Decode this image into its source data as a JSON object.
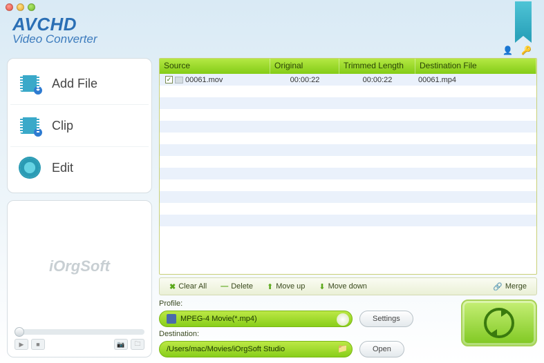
{
  "brand": {
    "line1": "AVCHD",
    "line2": "Video Converter"
  },
  "sidebar": {
    "items": [
      {
        "label": "Add File"
      },
      {
        "label": "Clip"
      },
      {
        "label": "Edit"
      }
    ]
  },
  "preview": {
    "watermark": "iOrgSoft"
  },
  "table": {
    "headers": {
      "source": "Source",
      "original": "Original",
      "trimmed": "Trimmed Length",
      "dest": "Destination File"
    },
    "rows": [
      {
        "checked": "✓",
        "source": "00061.mov",
        "original": "00:00:22",
        "trimmed": "00:00:22",
        "dest": "00061.mp4"
      }
    ]
  },
  "toolbar": {
    "clear_all": "Clear All",
    "delete": "Delete",
    "move_up": "Move up",
    "move_down": "Move down",
    "merge": "Merge"
  },
  "profile": {
    "label": "Profile:",
    "value": "MPEG-4 Movie(*.mp4)",
    "settings_btn": "Settings"
  },
  "destination": {
    "label": "Destination:",
    "value": "/Users/mac/Movies/iOrgSoft Studio",
    "open_btn": "Open"
  }
}
